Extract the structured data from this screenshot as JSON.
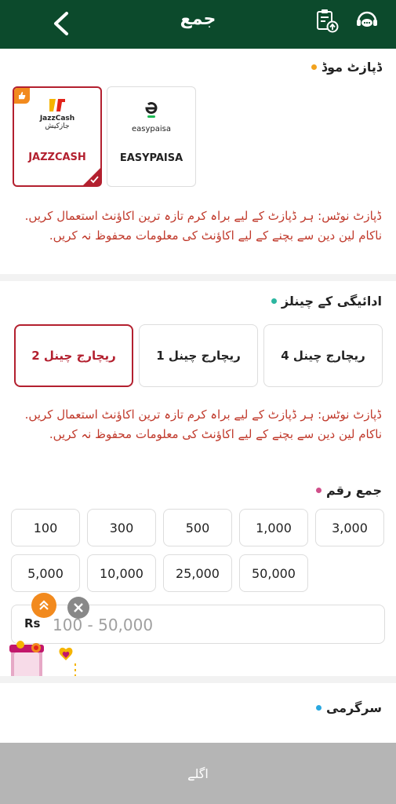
{
  "header": {
    "title": "جمع",
    "bg_color": "#0c4a2c"
  },
  "deposit_mode": {
    "title": "ڈپازٹ موڈ",
    "dot_color": "#f2a21e",
    "options": [
      {
        "label": "JAZZCASH",
        "logo_line1": "JazzCash",
        "logo_line2": "جازکیش",
        "selected": true
      },
      {
        "label": "EASYPAISA",
        "logo_text": "easypaisa",
        "selected": false
      }
    ]
  },
  "notice_text": "ڈپازٹ نوٹس: ہر ڈپازٹ کے لیے براہ کرم تازہ ترین اکاؤنٹ استعمال کریں. ناکام لین دین سے بچنے کے لیے اکاؤنٹ کی معلومات محفوظ نہ کریں.",
  "payment_channels": {
    "title": "ادائیگی کے چینلز",
    "dot_color": "#2bb6a0",
    "channels": [
      {
        "label": "ریچارج چینل 2",
        "selected": true
      },
      {
        "label": "ریچارج چینل 1",
        "selected": false
      },
      {
        "label": "ریچارج چینل 4",
        "selected": false
      }
    ]
  },
  "amount": {
    "title": "جمع رقم",
    "dot_color": "#d04f8a",
    "presets": [
      "100",
      "300",
      "500",
      "1,000",
      "3,000",
      "5,000",
      "10,000",
      "25,000",
      "50,000"
    ],
    "currency": "Rs",
    "placeholder": "100 - 50,000",
    "value": ""
  },
  "activity": {
    "title": "سرگرمی",
    "dot_color": "#2aa8e0"
  },
  "footer": {
    "next_label": "اگلے"
  },
  "accent_color": "#b3202f"
}
